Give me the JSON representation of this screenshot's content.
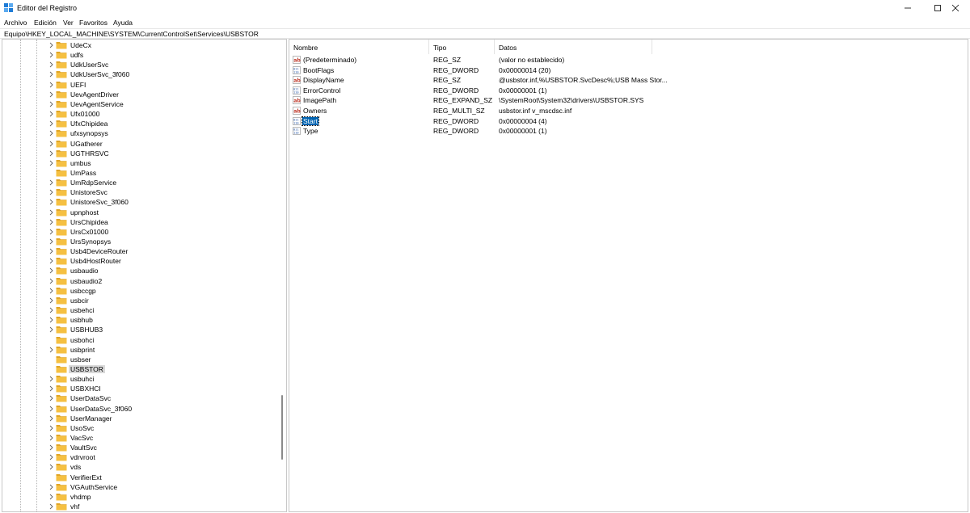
{
  "window": {
    "title": "Editor del Registro",
    "controls": {
      "minimize": "—",
      "maximize": "☐",
      "close": "✕"
    }
  },
  "menu": [
    "Archivo",
    "Edición",
    "Ver",
    "Favoritos",
    "Ayuda"
  ],
  "address": "Equipo\\HKEY_LOCAL_MACHINE\\SYSTEM\\CurrentControlSet\\Services\\USBSTOR",
  "tree": {
    "selected": "USBSTOR",
    "items": [
      {
        "label": "UdeCx",
        "expandable": true
      },
      {
        "label": "udfs",
        "expandable": true
      },
      {
        "label": "UdkUserSvc",
        "expandable": true
      },
      {
        "label": "UdkUserSvc_3f060",
        "expandable": true
      },
      {
        "label": "UEFI",
        "expandable": true
      },
      {
        "label": "UevAgentDriver",
        "expandable": true
      },
      {
        "label": "UevAgentService",
        "expandable": true
      },
      {
        "label": "Ufx01000",
        "expandable": true
      },
      {
        "label": "UfxChipidea",
        "expandable": true
      },
      {
        "label": "ufxsynopsys",
        "expandable": true
      },
      {
        "label": "UGatherer",
        "expandable": true
      },
      {
        "label": "UGTHRSVC",
        "expandable": true
      },
      {
        "label": "umbus",
        "expandable": true
      },
      {
        "label": "UmPass",
        "expandable": false
      },
      {
        "label": "UmRdpService",
        "expandable": true
      },
      {
        "label": "UnistoreSvc",
        "expandable": true
      },
      {
        "label": "UnistoreSvc_3f060",
        "expandable": true
      },
      {
        "label": "upnphost",
        "expandable": true
      },
      {
        "label": "UrsChipidea",
        "expandable": true
      },
      {
        "label": "UrsCx01000",
        "expandable": true
      },
      {
        "label": "UrsSynopsys",
        "expandable": true
      },
      {
        "label": "Usb4DeviceRouter",
        "expandable": true
      },
      {
        "label": "Usb4HostRouter",
        "expandable": true
      },
      {
        "label": "usbaudio",
        "expandable": true
      },
      {
        "label": "usbaudio2",
        "expandable": true
      },
      {
        "label": "usbccgp",
        "expandable": true
      },
      {
        "label": "usbcir",
        "expandable": true
      },
      {
        "label": "usbehci",
        "expandable": true
      },
      {
        "label": "usbhub",
        "expandable": true
      },
      {
        "label": "USBHUB3",
        "expandable": true
      },
      {
        "label": "usbohci",
        "expandable": false
      },
      {
        "label": "usbprint",
        "expandable": true
      },
      {
        "label": "usbser",
        "expandable": false
      },
      {
        "label": "USBSTOR",
        "expandable": false
      },
      {
        "label": "usbuhci",
        "expandable": true
      },
      {
        "label": "USBXHCI",
        "expandable": true
      },
      {
        "label": "UserDataSvc",
        "expandable": true
      },
      {
        "label": "UserDataSvc_3f060",
        "expandable": true
      },
      {
        "label": "UserManager",
        "expandable": true
      },
      {
        "label": "UsoSvc",
        "expandable": true
      },
      {
        "label": "VacSvc",
        "expandable": true
      },
      {
        "label": "VaultSvc",
        "expandable": true
      },
      {
        "label": "vdrvroot",
        "expandable": true
      },
      {
        "label": "vds",
        "expandable": true
      },
      {
        "label": "VerifierExt",
        "expandable": false
      },
      {
        "label": "VGAuthService",
        "expandable": true
      },
      {
        "label": "vhdmp",
        "expandable": true
      },
      {
        "label": "vhf",
        "expandable": true
      }
    ]
  },
  "values": {
    "columns": [
      "Nombre",
      "Tipo",
      "Datos"
    ],
    "selected": "Start",
    "rows": [
      {
        "name": "(Predeterminado)",
        "type": "REG_SZ",
        "data": "(valor no establecido)",
        "icon": "string-value-icon"
      },
      {
        "name": "BootFlags",
        "type": "REG_DWORD",
        "data": "0x00000014 (20)",
        "icon": "binary-value-icon"
      },
      {
        "name": "DisplayName",
        "type": "REG_SZ",
        "data": "@usbstor.inf,%USBSTOR.SvcDesc%;USB Mass Stor...",
        "icon": "string-value-icon"
      },
      {
        "name": "ErrorControl",
        "type": "REG_DWORD",
        "data": "0x00000001 (1)",
        "icon": "binary-value-icon"
      },
      {
        "name": "ImagePath",
        "type": "REG_EXPAND_SZ",
        "data": "\\SystemRoot\\System32\\drivers\\USBSTOR.SYS",
        "icon": "string-value-icon"
      },
      {
        "name": "Owners",
        "type": "REG_MULTI_SZ",
        "data": "usbstor.inf v_mscdsc.inf",
        "icon": "string-value-icon"
      },
      {
        "name": "Start",
        "type": "REG_DWORD",
        "data": "0x00000004 (4)",
        "icon": "binary-value-icon"
      },
      {
        "name": "Type",
        "type": "REG_DWORD",
        "data": "0x00000001 (1)",
        "icon": "binary-value-icon"
      }
    ]
  },
  "colors": {
    "folder": "#f5c042",
    "folder_dark": "#e0a526",
    "selection": "#0063b1",
    "tree_selection": "#d9d9d9"
  }
}
